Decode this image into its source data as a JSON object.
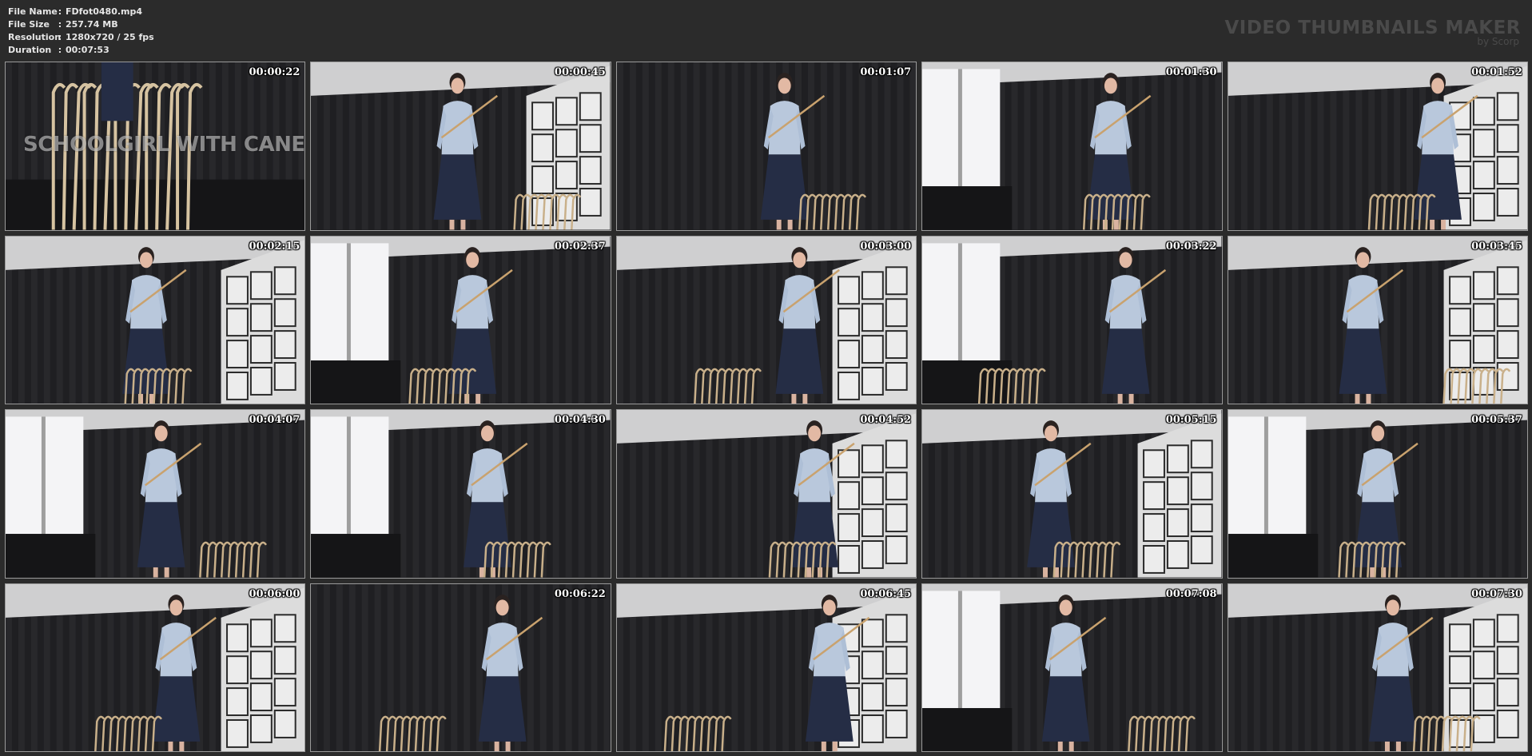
{
  "file_info": {
    "name_label": "File Name",
    "name_value": "FDfot0480.mp4",
    "size_label": "File Size",
    "size_value": "257.74 MB",
    "resolution_label": "Resolution",
    "resolution_value": "1280x720 / 25 fps",
    "duration_label": "Duration",
    "duration_value": "00:07:53",
    "separator": ":"
  },
  "brand": {
    "title": "VIDEO THUMBNAILS MAKER",
    "subtitle": "by Scorp"
  },
  "overlay_text": "SCHOOLGIRL WITH CANES",
  "thumbnails": [
    {
      "time": "00:00:22",
      "scene": "canes-closeup"
    },
    {
      "time": "00:00:45",
      "scene": "right-panels"
    },
    {
      "time": "00:01:07",
      "scene": "curtain-only"
    },
    {
      "time": "00:01:30",
      "scene": "window-left"
    },
    {
      "time": "00:01:52",
      "scene": "right-panels"
    },
    {
      "time": "00:02:15",
      "scene": "right-panels"
    },
    {
      "time": "00:02:37",
      "scene": "window-left"
    },
    {
      "time": "00:03:00",
      "scene": "right-panels"
    },
    {
      "time": "00:03:22",
      "scene": "window-left"
    },
    {
      "time": "00:03:45",
      "scene": "right-panels"
    },
    {
      "time": "00:04:07",
      "scene": "window-left"
    },
    {
      "time": "00:04:30",
      "scene": "window-left"
    },
    {
      "time": "00:04:52",
      "scene": "right-panels"
    },
    {
      "time": "00:05:15",
      "scene": "right-panels"
    },
    {
      "time": "00:05:37",
      "scene": "window-left"
    },
    {
      "time": "00:06:00",
      "scene": "right-panels"
    },
    {
      "time": "00:06:22",
      "scene": "curtain-only"
    },
    {
      "time": "00:06:45",
      "scene": "right-panels"
    },
    {
      "time": "00:07:08",
      "scene": "window-left"
    },
    {
      "time": "00:07:30",
      "scene": "right-panels"
    }
  ]
}
